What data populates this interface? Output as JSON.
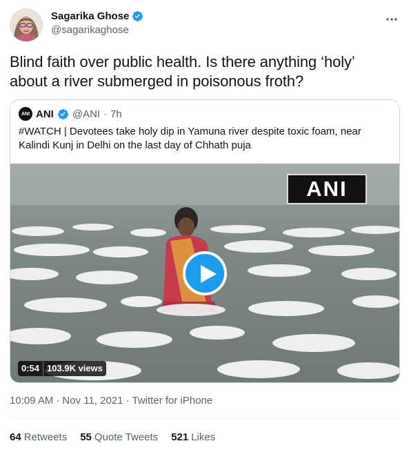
{
  "author": {
    "name": "Sagarika Ghose",
    "handle": "@sagarikaghose",
    "verified_icon": "verified-badge-icon",
    "more_icon": "more-dots-icon"
  },
  "tweet_text": "Blind faith over public health. Is there anything ‘holy’ about a river submerged in poisonous froth?",
  "quoted": {
    "avatar_text": "ANI",
    "name": "ANI",
    "handle": "@ANI",
    "separator": "·",
    "time": "7h",
    "text": "#WATCH | Devotees take holy dip in Yamuna river despite toxic foam, near Kalindi Kunj in Delhi on the last day of Chhath puja",
    "video": {
      "watermark": "ANI",
      "duration": "0:54",
      "views": "103.9K views",
      "play_icon": "play-icon"
    }
  },
  "meta": {
    "time": "10:09 AM",
    "separator1": "·",
    "date": "Nov 11, 2021",
    "separator2": "·",
    "source": "Twitter for iPhone"
  },
  "stats": {
    "retweets_count": "64",
    "retweets_label": "Retweets",
    "quotes_count": "55",
    "quotes_label": "Quote Tweets",
    "likes_count": "521",
    "likes_label": "Likes"
  },
  "colors": {
    "accent": "#1d9bf0",
    "secondary_text": "#536471",
    "border": "#cfd9de"
  }
}
